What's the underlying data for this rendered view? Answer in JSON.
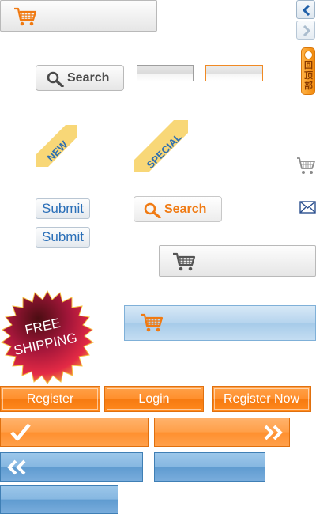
{
  "icons": {
    "cart": "shopping-cart-icon",
    "search": "magnifier-icon",
    "mail": "envelope-icon"
  },
  "colors": {
    "orange": "#ff8a1e",
    "blue": "#79acdc",
    "link_blue": "#2a6fb8",
    "badge_red": "#b5123c"
  },
  "back_to_top": {
    "label": "回顶部"
  },
  "search": {
    "grey_label": "Search",
    "orange_label": "Search"
  },
  "ribbons": {
    "new": "NEW",
    "special": "SPECIAL"
  },
  "submit": {
    "label1": "Submit",
    "label2": "Submit"
  },
  "badge": {
    "line1": "FREE",
    "line2": "SHIPPING"
  },
  "buttons": {
    "register": "Register",
    "login": "Login",
    "register_now": "Register Now"
  }
}
